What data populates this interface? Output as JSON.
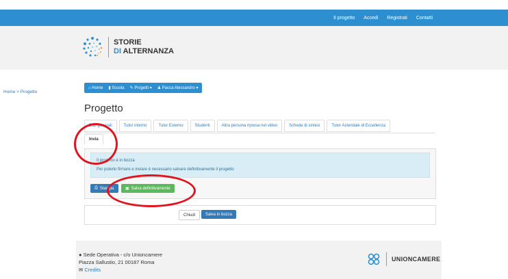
{
  "topnav": {
    "links": [
      "Il progetto",
      "Accedi",
      "Registrati",
      "Contatti"
    ]
  },
  "logo": {
    "line1": "STORIE",
    "line2_prefix": "DI ",
    "line2_accent": "ALTERNANZA"
  },
  "breadcrumb": "Home > Progetto",
  "actionbar": {
    "home": "Home",
    "scuola": "Scuola",
    "progetti": "Progetti",
    "user": "Pacca Alessandro"
  },
  "page_title": "Progetto",
  "tabs": {
    "row1": [
      "Dati generali",
      "Tutor interno",
      "Tutor Esterno",
      "Studenti",
      "Altra persona ripresa nel video",
      "Scheda di sintesi",
      "Tutor Aziendale di Eccellenza"
    ],
    "row2": [
      "Invia"
    ]
  },
  "alert": {
    "line1": "Il progetto è in bozza",
    "line2": "Per poterlo firmare e inviare è necessario salvare definitivamente il progetto"
  },
  "buttons": {
    "stampa": "Stampa",
    "salva_def": "Salva definitivamente",
    "chiudi": "Chiudi",
    "salva_bozza": "Salva in bozza"
  },
  "footer": {
    "line1": "Sede Operativa - c/o Unioncamere",
    "line2": "Piazza Sallustio, 21 00187 Roma",
    "credits": "Credits",
    "brand": "UNIONCAMERE"
  },
  "colors": {
    "primary": "#2e8fd0",
    "success": "#5cb85c",
    "annotation": "#e0141e"
  }
}
